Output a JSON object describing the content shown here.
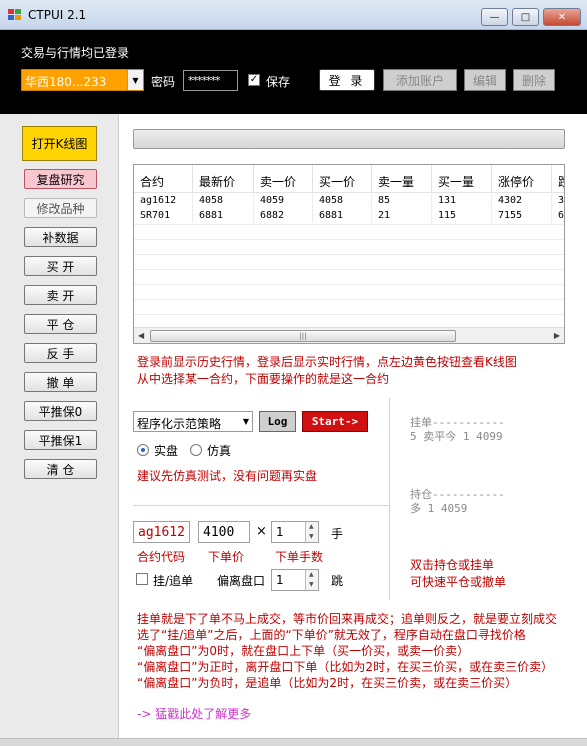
{
  "window": {
    "title": "CTPUI 2.1",
    "min": "—",
    "max": "□",
    "close": "✕"
  },
  "header": {
    "status": "交易与行情均已登录",
    "account": "华西180...233",
    "password_label": "密码",
    "password_value": "*******",
    "save_label": "保存",
    "save_checked": "✓",
    "login_label": "登 录",
    "add_account_label": "添加账户",
    "edit_label": "编辑",
    "delete_label": "删除"
  },
  "sidebar": {
    "kline": "打开K线图",
    "review": "复盘研究",
    "modify": "修改品种",
    "backfill": "补数据",
    "buy_open": "买 开",
    "sell_open": "卖 开",
    "close": "平 仓",
    "reverse": "反 手",
    "cancel": "撤 单",
    "flat_keep0": "平推保0",
    "flat_keep1": "平推保1",
    "clear": "清 仓"
  },
  "grid": {
    "columns": [
      "合约",
      "最新价",
      "卖一价",
      "买一价",
      "卖一量",
      "买一量",
      "涨停价",
      "跌"
    ],
    "rows": [
      [
        "ag1612",
        "4058",
        "4059",
        "4058",
        "85",
        "131",
        "4302",
        "3"
      ],
      [
        "SR701",
        "6881",
        "6882",
        "6881",
        "21",
        "115",
        "7155",
        "6"
      ]
    ],
    "scroll_left": "◀",
    "scroll_right": "▶",
    "scroll_grip": "|||"
  },
  "notes": {
    "line1": "登录前显示历史行情，登录后显示实时行情，点左边黄色按钮查看K线图",
    "line2": "从中选择某一合约，下面要操作的就是这一合约"
  },
  "strategy": {
    "selected": "程序化示范策略",
    "log_label": "Log",
    "start_label": "Start->",
    "radio_real": "实盘",
    "radio_sim": "仿真",
    "advice": "建议先仿真测试，没有问题再实盘"
  },
  "order": {
    "contract": "ag1612",
    "price": "4100",
    "times": "×",
    "qty": "1",
    "unit": "手",
    "contract_label": "合约代码",
    "price_label": "下单价",
    "qty_label": "下单手数",
    "chase_label": "挂/追单",
    "offset_label": "偏离盘口",
    "offset_value": "1",
    "offset_unit": "跳"
  },
  "info": {
    "pending_title": "挂单-----------",
    "pending_value": "5 卖平今 1 4099",
    "position_title": "持仓-----------",
    "position_value": "多 1 4059",
    "hint1": "双击持仓或挂单",
    "hint2": "可快速平仓或撤单"
  },
  "help": {
    "l1": "挂单就是下了单不马上成交，等市价回来再成交；追单则反之，就是要立刻成交",
    "l2": "选了“挂/追单”之后，上面的“下单价”就无效了，程序自动在盘口寻找价格",
    "l3": "“偏离盘口”为0时，就在盘口上下单（买一价买，或卖一价卖）",
    "l4": "“偏离盘口”为正时，离开盘口下单（比如为2时，在买三价买，或在卖三价卖）",
    "l5": "“偏离盘口”为负时，是追单（比如为2时，在买三价卖，或在卖三价买）",
    "more": "-> 猛戳此处了解更多"
  },
  "colors": {
    "header_bg": "#000000",
    "account_bg": "#ffa200",
    "kline_btn": "#ffd400",
    "review_btn": "#f9c7d0",
    "start_btn": "#d01010",
    "note_red": "#c00000",
    "more_link": "#cc33cc"
  }
}
